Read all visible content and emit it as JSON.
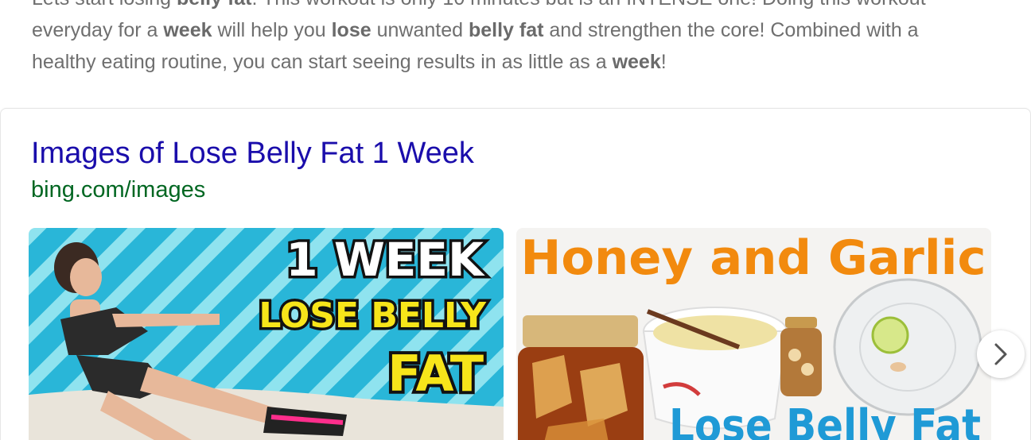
{
  "snippet": {
    "line0": {
      "a": "Lets start losing ",
      "b1": "belly fat",
      "c": ". This workout is only 10 minutes but is an INTENSE one! Doing this workout"
    },
    "line1": {
      "a": "everyday for a ",
      "b1": "week",
      "c": " will help you ",
      "b2": "lose",
      "d": " unwanted ",
      "b3": "belly fat",
      "e": " and strengthen the core! Combined with a"
    },
    "line2": {
      "a": "healthy eating routine, you can start seeing results in as little as a ",
      "b1": "week",
      "c": "!"
    }
  },
  "images_card": {
    "title": "Images of Lose Belly Fat 1 Week",
    "url": "bing.com/images",
    "thumbnails": [
      {
        "line1": "1 WEEK",
        "line2": "LOSE BELLY",
        "line3": "FAT"
      },
      {
        "top_text": "Honey and Garlic",
        "bottom_text": "Lose Belly Fat"
      }
    ],
    "next_icon": "chevron-right-icon"
  },
  "colors": {
    "title_link": "#1a0dab",
    "url_green": "#006621",
    "snippet_gray": "#6f6f6f",
    "thumb1_bg": "#2bb7d9",
    "thumb1_yellow": "#f7e51a",
    "thumb2_orange": "#f28a0e",
    "thumb2_blue": "#1f9ad6"
  }
}
